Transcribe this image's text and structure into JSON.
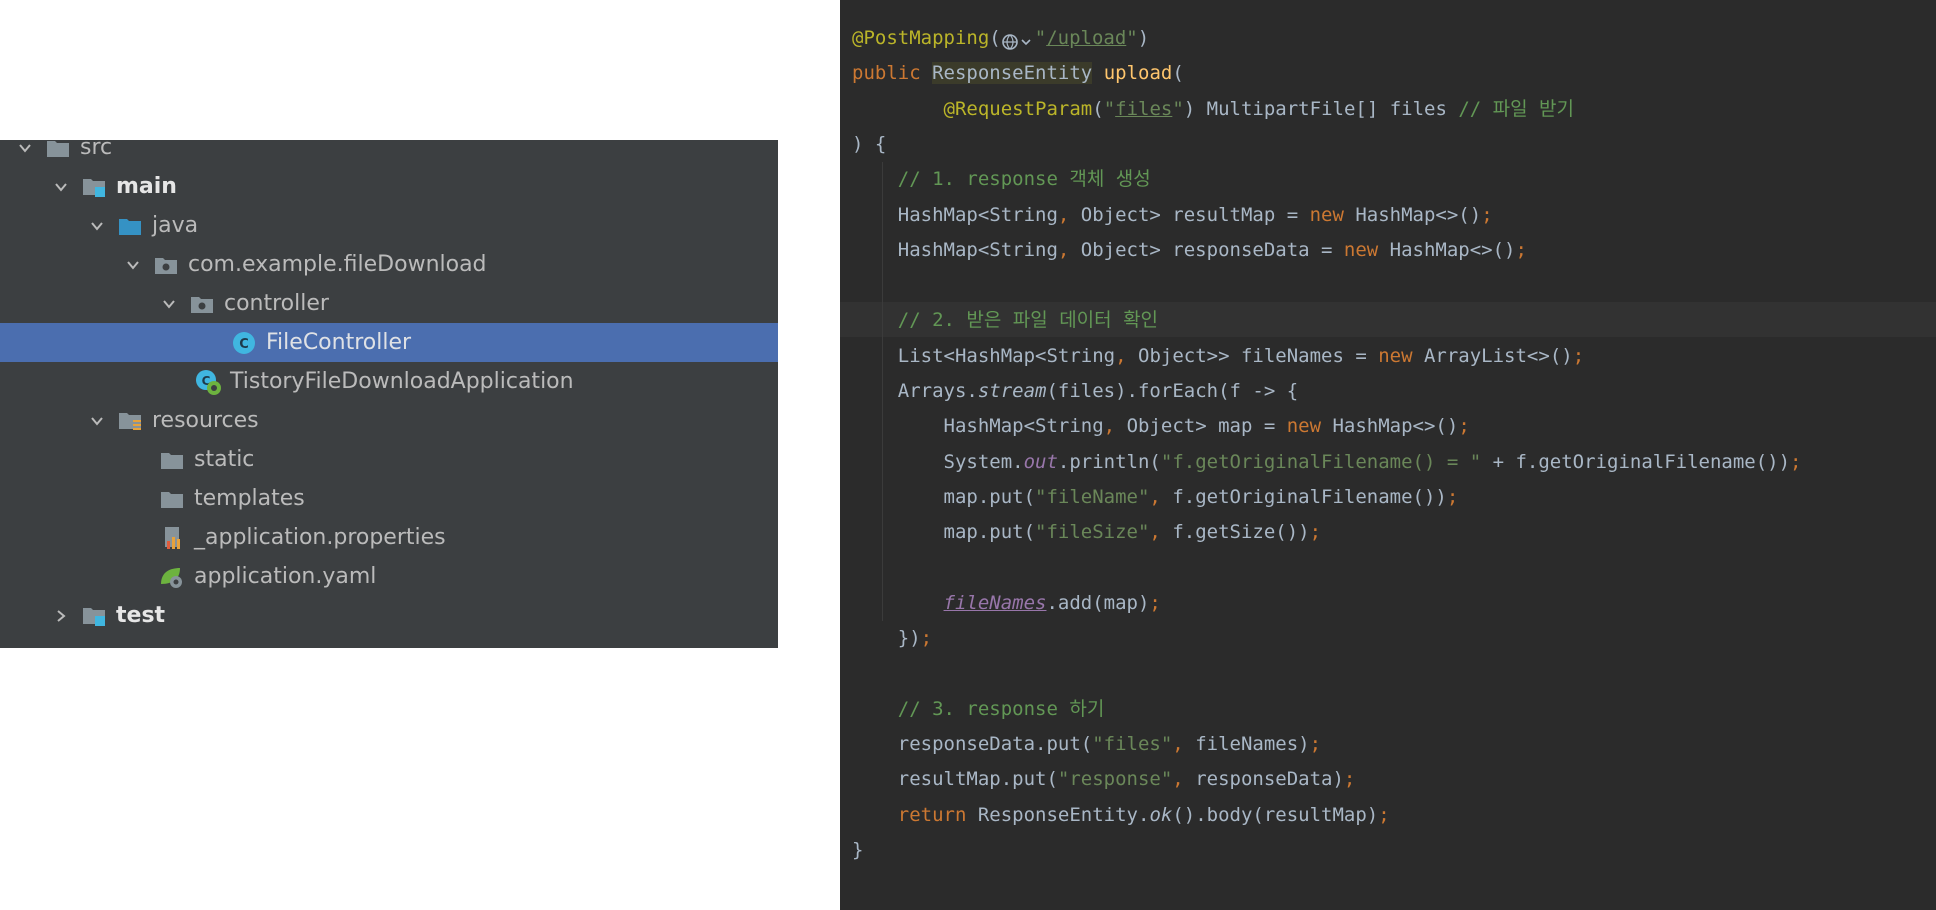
{
  "project_tree": {
    "items": [
      {
        "label": "src",
        "bold": false,
        "icon": "folder-icon",
        "chevron": "down"
      },
      {
        "label": "main",
        "bold": true,
        "icon": "source-root-folder-icon",
        "chevron": "down"
      },
      {
        "label": "java",
        "bold": false,
        "icon": "java-source-folder-icon",
        "chevron": "down"
      },
      {
        "label": "com.example.fileDownload",
        "bold": false,
        "icon": "package-icon",
        "chevron": "down"
      },
      {
        "label": "controller",
        "bold": false,
        "icon": "package-icon",
        "chevron": "down"
      },
      {
        "label": "FileController",
        "bold": false,
        "icon": "java-class-icon",
        "chevron": "none",
        "selected": true
      },
      {
        "label": "TistoryFileDownloadApplication",
        "bold": false,
        "icon": "spring-boot-app-icon",
        "chevron": "none"
      },
      {
        "label": "resources",
        "bold": false,
        "icon": "resources-folder-icon",
        "chevron": "down"
      },
      {
        "label": "static",
        "bold": false,
        "icon": "folder-icon",
        "chevron": "none"
      },
      {
        "label": "templates",
        "bold": false,
        "icon": "folder-icon",
        "chevron": "none"
      },
      {
        "label": "_application.properties",
        "bold": false,
        "icon": "properties-file-icon",
        "chevron": "none"
      },
      {
        "label": "application.yaml",
        "bold": false,
        "icon": "spring-yaml-file-icon",
        "chevron": "none"
      },
      {
        "label": "test",
        "bold": true,
        "icon": "test-folder-icon",
        "chevron": "right"
      }
    ]
  },
  "editor": {
    "lines": [
      [
        {
          "t": "@PostMapping",
          "c": "ann"
        },
        {
          "t": "("
        },
        {
          "t": "",
          "c": "webicon"
        },
        {
          "t": "\"",
          "c": "str"
        },
        {
          "t": "/upload",
          "c": "str uline"
        },
        {
          "t": "\"",
          "c": "str"
        },
        {
          "t": ")"
        }
      ],
      [
        {
          "t": "public ",
          "c": "kw"
        },
        {
          "t": "ResponseEntity",
          "c": "hl-type"
        },
        {
          "t": " "
        },
        {
          "t": "upload",
          "c": "fn"
        },
        {
          "t": "("
        }
      ],
      [
        {
          "t": "        "
        },
        {
          "t": "@RequestParam",
          "c": "ann"
        },
        {
          "t": "("
        },
        {
          "t": "\"",
          "c": "str"
        },
        {
          "t": "files",
          "c": "str uline"
        },
        {
          "t": "\"",
          "c": "str"
        },
        {
          "t": ") MultipartFile[] files "
        },
        {
          "t": "// 파일 받기",
          "c": "cmt"
        }
      ],
      [
        {
          "t": ") {"
        }
      ],
      [
        {
          "t": "    "
        },
        {
          "t": "// 1. response 객체 생성",
          "c": "cmt"
        }
      ],
      [
        {
          "t": "    HashMap<String"
        },
        {
          "t": ", ",
          "c": "kw"
        },
        {
          "t": "Object> resultMap = "
        },
        {
          "t": "new ",
          "c": "kw"
        },
        {
          "t": "HashMap<>()"
        },
        {
          "t": ";",
          "c": "kw"
        }
      ],
      [
        {
          "t": "    HashMap<String"
        },
        {
          "t": ", ",
          "c": "kw"
        },
        {
          "t": "Object> responseData = "
        },
        {
          "t": "new ",
          "c": "kw"
        },
        {
          "t": "HashMap<>()"
        },
        {
          "t": ";",
          "c": "kw"
        }
      ],
      [],
      [
        {
          "t": "    "
        },
        {
          "t": "// 2. 받은 파일 데이터 확인",
          "c": "cmt"
        }
      ],
      [
        {
          "t": "    List<HashMap<String"
        },
        {
          "t": ", ",
          "c": "kw"
        },
        {
          "t": "Object>> fileNames = "
        },
        {
          "t": "new ",
          "c": "kw"
        },
        {
          "t": "ArrayList<>()"
        },
        {
          "t": ";",
          "c": "kw"
        }
      ],
      [
        {
          "t": "    Arrays."
        },
        {
          "t": "stream",
          "c": "ital"
        },
        {
          "t": "(files).forEach(f -> {"
        }
      ],
      [
        {
          "t": "        HashMap<String"
        },
        {
          "t": ", ",
          "c": "kw"
        },
        {
          "t": "Object> map = "
        },
        {
          "t": "new ",
          "c": "kw"
        },
        {
          "t": "HashMap<>()"
        },
        {
          "t": ";",
          "c": "kw"
        }
      ],
      [
        {
          "t": "        System."
        },
        {
          "t": "out",
          "c": "fld"
        },
        {
          "t": ".println("
        },
        {
          "t": "\"f.getOriginalFilename() = \"",
          "c": "str"
        },
        {
          "t": " + f.getOriginalFilename())"
        },
        {
          "t": ";",
          "c": "kw"
        }
      ],
      [
        {
          "t": "        map.put("
        },
        {
          "t": "\"fileName\"",
          "c": "str"
        },
        {
          "t": ", ",
          "c": "kw"
        },
        {
          "t": "f.getOriginalFilename())"
        },
        {
          "t": ";",
          "c": "kw"
        }
      ],
      [
        {
          "t": "        map.put("
        },
        {
          "t": "\"fileSize\"",
          "c": "str"
        },
        {
          "t": ", ",
          "c": "kw"
        },
        {
          "t": "f.getSize())"
        },
        {
          "t": ";",
          "c": "kw"
        }
      ],
      [],
      [
        {
          "t": "        "
        },
        {
          "t": "fileNames",
          "c": "fld uline"
        },
        {
          "t": ".add(map)"
        },
        {
          "t": ";",
          "c": "kw"
        }
      ],
      [
        {
          "t": "    })"
        },
        {
          "t": ";",
          "c": "kw"
        }
      ],
      [],
      [
        {
          "t": "    "
        },
        {
          "t": "// 3. response 하기",
          "c": "cmt"
        }
      ],
      [
        {
          "t": "    responseData.put("
        },
        {
          "t": "\"files\"",
          "c": "str"
        },
        {
          "t": ", ",
          "c": "kw"
        },
        {
          "t": "fileNames)"
        },
        {
          "t": ";",
          "c": "kw"
        }
      ],
      [
        {
          "t": "    resultMap.put("
        },
        {
          "t": "\"response\"",
          "c": "str"
        },
        {
          "t": ", ",
          "c": "kw"
        },
        {
          "t": "responseData)"
        },
        {
          "t": ";",
          "c": "kw"
        }
      ],
      [
        {
          "t": "    "
        },
        {
          "t": "return ",
          "c": "kw"
        },
        {
          "t": "ResponseEntity."
        },
        {
          "t": "ok",
          "c": "ital"
        },
        {
          "t": "().body(resultMap)"
        },
        {
          "t": ";",
          "c": "kw"
        }
      ],
      [
        {
          "t": "}"
        }
      ]
    ]
  },
  "colors": {
    "tree_bg": "#3c3f41",
    "tree_selected": "#4b6eaf",
    "editor_bg": "#2b2b2b",
    "keyword": "#cc7832",
    "annotation": "#bbb529",
    "string": "#6a8759",
    "comment": "#629755",
    "method_decl": "#ffc66d",
    "field": "#9876aa",
    "default_text": "#a9b7c6"
  }
}
